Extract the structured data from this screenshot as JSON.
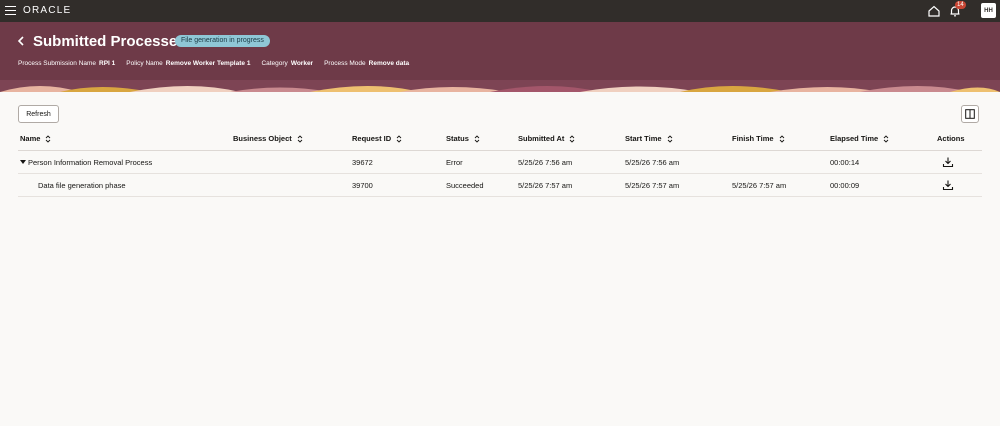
{
  "topbar": {
    "logo_text": "ORACLE",
    "notification_count": "14",
    "avatar_initials": "HH"
  },
  "header": {
    "title": "Submitted Processes",
    "status_badge": "File generation in progress",
    "meta": [
      {
        "label": "Process Submission Name",
        "value": "RPI 1"
      },
      {
        "label": "Policy Name",
        "value": "Remove Worker Template 1"
      },
      {
        "label": "Category",
        "value": "Worker"
      },
      {
        "label": "Process Mode",
        "value": "Remove data"
      }
    ]
  },
  "toolbar": {
    "refresh_label": "Refresh"
  },
  "table": {
    "columns": [
      "Name",
      "Business Object",
      "Request ID",
      "Status",
      "Submitted At",
      "Start Time",
      "Finish Time",
      "Elapsed Time",
      "Actions"
    ],
    "rows": [
      {
        "name": "Person Information Removal Process",
        "business_object": "",
        "request_id": "39672",
        "status": "Error",
        "submitted_at": "5/25/26 7:56 am",
        "start_time": "5/25/26 7:56 am",
        "finish_time": "",
        "elapsed_time": "00:00:14"
      },
      {
        "name": "Data file generation phase",
        "business_object": "",
        "request_id": "39700",
        "status": "Succeeded",
        "submitted_at": "5/25/26 7:57 am",
        "start_time": "5/25/26 7:57 am",
        "finish_time": "5/25/26 7:57 am",
        "elapsed_time": "00:00:09"
      }
    ]
  },
  "colors": {
    "topbar": "#312d2a",
    "header": "#6e3a48",
    "badge": "#8fc7d6"
  }
}
